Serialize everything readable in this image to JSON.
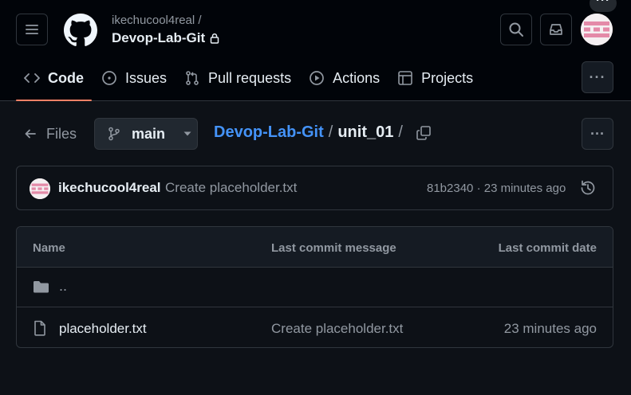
{
  "header": {
    "owner": "ikechucool4real /",
    "repo": "Devop-Lab-Git",
    "avatar_more": "···"
  },
  "tabs": [
    {
      "label": "Code",
      "icon": "code-icon",
      "active": true
    },
    {
      "label": "Issues",
      "icon": "issue-opened-icon",
      "active": false
    },
    {
      "label": "Pull requests",
      "icon": "git-pull-request-icon",
      "active": false
    },
    {
      "label": "Actions",
      "icon": "play-icon",
      "active": false
    },
    {
      "label": "Projects",
      "icon": "table-icon",
      "active": false
    }
  ],
  "more_label": "···",
  "pathbar": {
    "files_label": "Files",
    "branch": "main",
    "repo": "Devop-Lab-Git",
    "sep": "/",
    "folder": "unit_01",
    "trailing_sep": "/"
  },
  "commit": {
    "author": "ikechucool4real",
    "message": "Create placeholder.txt",
    "meta": "81b2340 · 23 minutes ago"
  },
  "table": {
    "headers": {
      "name": "Name",
      "message": "Last commit message",
      "date": "Last commit date"
    },
    "up_row": "..",
    "rows": [
      {
        "name": "placeholder.txt",
        "message": "Create placeholder.txt",
        "date": "23 minutes ago"
      }
    ]
  },
  "colors": {
    "accent_tab": "#f78166",
    "link": "#4493f8",
    "border": "#30363d",
    "bg": "#0d1117",
    "header_bg": "#010409"
  }
}
